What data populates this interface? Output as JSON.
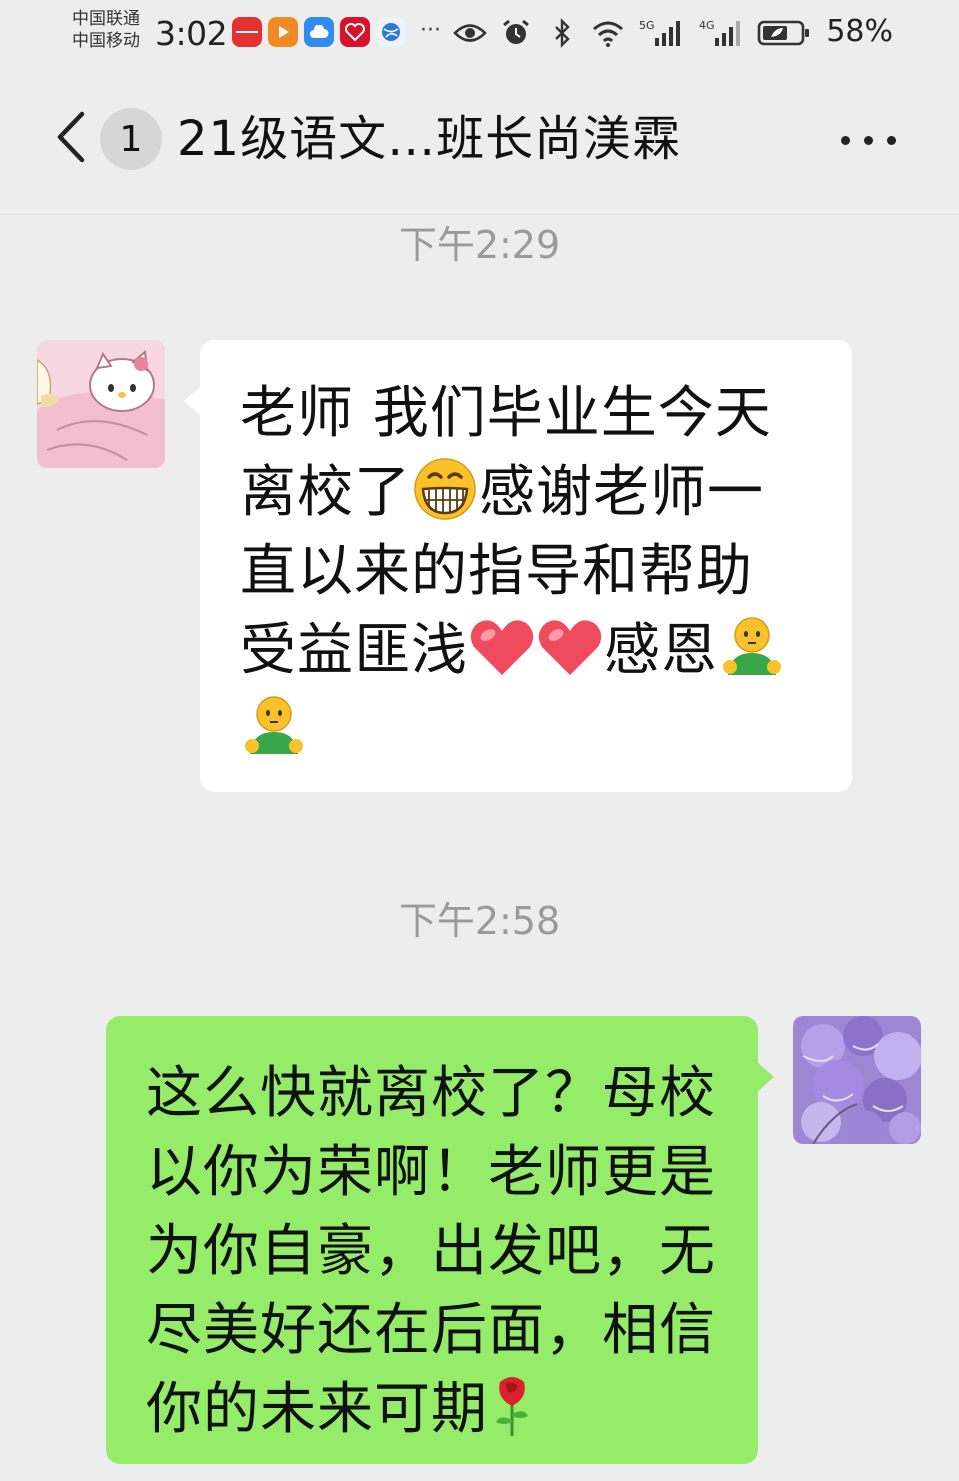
{
  "status_bar": {
    "carrier_1": "中国联通",
    "carrier_2": "中国移动",
    "time": "3:02",
    "more": "···",
    "network_1": "5G",
    "network_2": "4G",
    "battery": "58%",
    "app_icons": [
      "huawei-icon",
      "video-app-icon",
      "cloud-app-icon",
      "heart-app-icon",
      "browser-icon"
    ],
    "status_icons": [
      "eye-icon",
      "alarm-icon",
      "bluetooth-icon",
      "wifi-icon",
      "signal-5g-icon",
      "signal-4g-icon",
      "battery-icon"
    ]
  },
  "header": {
    "back_icon": "chevron-left-icon",
    "unread_count": "1",
    "title": "21级语文…班长尚渼霖",
    "more_icon": "more-dots-icon"
  },
  "messages": [
    {
      "time": "下午2:29",
      "side": "left",
      "avatar_icon": "hello-kitty-avatar",
      "lines": [
        {
          "parts": [
            "老师 我们毕业生今天"
          ]
        },
        {
          "parts": [
            "离校了",
            "[grin-emoji]",
            "感谢老师一"
          ]
        },
        {
          "parts": [
            "直以来的指导和帮助"
          ]
        },
        {
          "parts": [
            "受益匪浅",
            "[heart-emoji]",
            "[heart-emoji]",
            "感恩",
            "[bow-emoji]"
          ]
        },
        {
          "parts": [
            "[bow-emoji]"
          ]
        }
      ],
      "text": {
        "l1": "老师 我们毕业生今天",
        "l2a": "离校了",
        "l2b": "感谢老师一",
        "l3": "直以来的指导和帮助",
        "l4a": "受益匪浅",
        "l4b": "感恩"
      }
    },
    {
      "time": "下午2:58",
      "side": "right",
      "avatar_icon": "purple-flowers-avatar",
      "text": {
        "l1": "这么快就离校了？母校",
        "l2": "以你为荣啊！老师更是",
        "l3": "为你自豪，出发吧，无",
        "l4": "尽美好还在后面，相信",
        "l5": "你的未来可期"
      }
    }
  ],
  "colors": {
    "background": "#ededed",
    "bubble_received": "#ffffff",
    "bubble_sent": "#95ec69",
    "timestamp": "#9a9a9a"
  }
}
